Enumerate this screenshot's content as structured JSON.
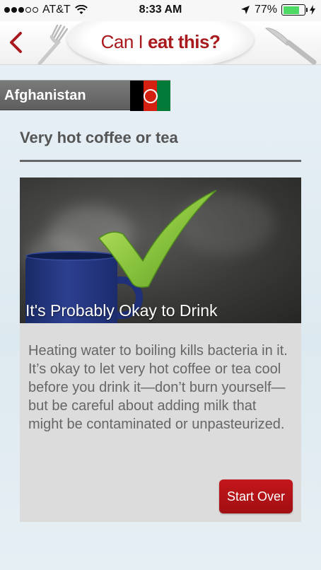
{
  "status_bar": {
    "carrier": "AT&T",
    "time": "8:33 AM",
    "battery_percent": "77%",
    "battery_level": 0.77,
    "signal_bars_filled": 3,
    "signal_bars_total": 5
  },
  "header": {
    "title_prefix": "Can I ",
    "title_emphasis": "eat this?",
    "accent_color": "#a81a1d"
  },
  "country": {
    "name": "Afghanistan",
    "flag_colors": [
      "#000000",
      "#d32011",
      "#007a36"
    ]
  },
  "food": {
    "title": "Very hot coffee or tea"
  },
  "result": {
    "label": "It's Probably Okay to Drink",
    "icon": "green-checkmark-icon",
    "description": "Heating water to boiling kills bacteria in it. It’s okay to let very hot coffee or tea cool before you drink it—don’t burn yourself—but be careful about adding milk that might be contaminated or unpasteurized."
  },
  "actions": {
    "start_over_label": "Start Over"
  }
}
